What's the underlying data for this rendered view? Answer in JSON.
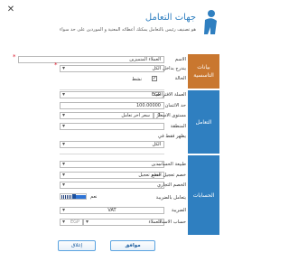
{
  "dialog": {
    "title": "جهات التعامل",
    "subtitle": "هو تصنيف رئيس بالتعامل   يمكنك أعطائه المعنية و الموردين على حد سواء",
    "close_glyph": "✕"
  },
  "sections": {
    "basic": {
      "label": "بيانات التاسسية",
      "color": "#c9772f"
    },
    "dealing": {
      "label": "التعامل",
      "color": "#2f7fc0"
    },
    "accounts": {
      "label": "الحسابات",
      "color": "#2f7fc0"
    }
  },
  "basic": {
    "name_label": "الاسم",
    "name_value": "العملاء المتميزين",
    "included_label": "يندرج بداخل",
    "included_value": "الكل",
    "status_label": "الحالة",
    "active_label": "نشط",
    "active_checked": true
  },
  "dealing": {
    "default_currency_label": "العملة الافتراضية",
    "default_currency_value": "EGP",
    "credit_limit_label": "حد الائتمان",
    "credit_limit_value": "100.00000",
    "price_level_label": "مستوى الاسعار",
    "price_level_value": "سعر اخر تعامل",
    "price_level_num": "0",
    "region_label": "المنطقة",
    "region_value": "",
    "show_only_in_label": "يظهر فقط في",
    "show_only_in_value": "الكل"
  },
  "accounts": {
    "account_type_label": "طبيعة الحساب",
    "account_type_value": "مدين",
    "payment_discount_label": "خصم تعجيل الدفع",
    "payment_discount_value": "خصم تعجيل",
    "trade_discount_label": "الخصم التجاري",
    "trade_discount_value": "",
    "tax_treatment_label": "يتعامل بالضريبة",
    "tax_treatment_value": "نعم",
    "tax_label": "الضريبة",
    "tax_value": "VAT",
    "reference_account_label": "حساب الاسناد",
    "reference_account_value": "العملاء",
    "reference_account_currency": "EGP"
  },
  "buttons": {
    "ok": "موافق",
    "cancel": "إغلاق"
  },
  "colors": {
    "accent": "#2f7fc0",
    "orange": "#c9772f",
    "toggle": "#2e74d6"
  }
}
